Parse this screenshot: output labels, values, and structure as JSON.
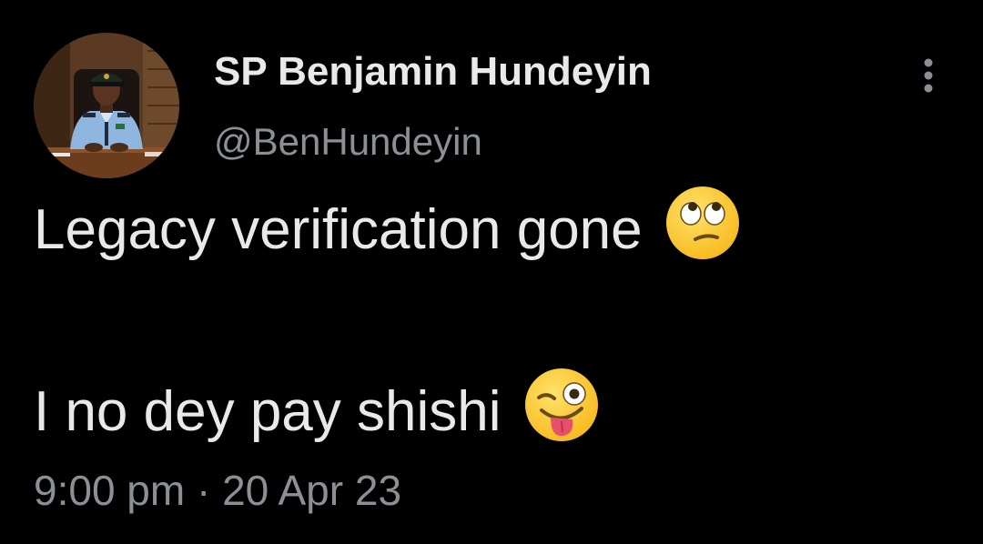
{
  "user": {
    "display_name": "SP Benjamin Hundeyin",
    "handle": "@BenHundeyin",
    "avatar_icon": "profile-photo-avatar"
  },
  "tweet": {
    "line1_text": "Legacy verification gone",
    "line1_emoji": "face-with-rolling-eyes-emoji",
    "line2_text": "I no dey pay shishi",
    "line2_emoji": "winking-face-with-tongue-emoji"
  },
  "meta": {
    "timestamp": "9:00 pm · 20 Apr 23"
  },
  "actions": {
    "more_icon": "vertical-ellipsis-icon"
  },
  "colors": {
    "background": "#000000",
    "primary_text": "#e7e9ea",
    "secondary_text": "#8b9095",
    "emoji_yellow": "#ffcc4d"
  }
}
